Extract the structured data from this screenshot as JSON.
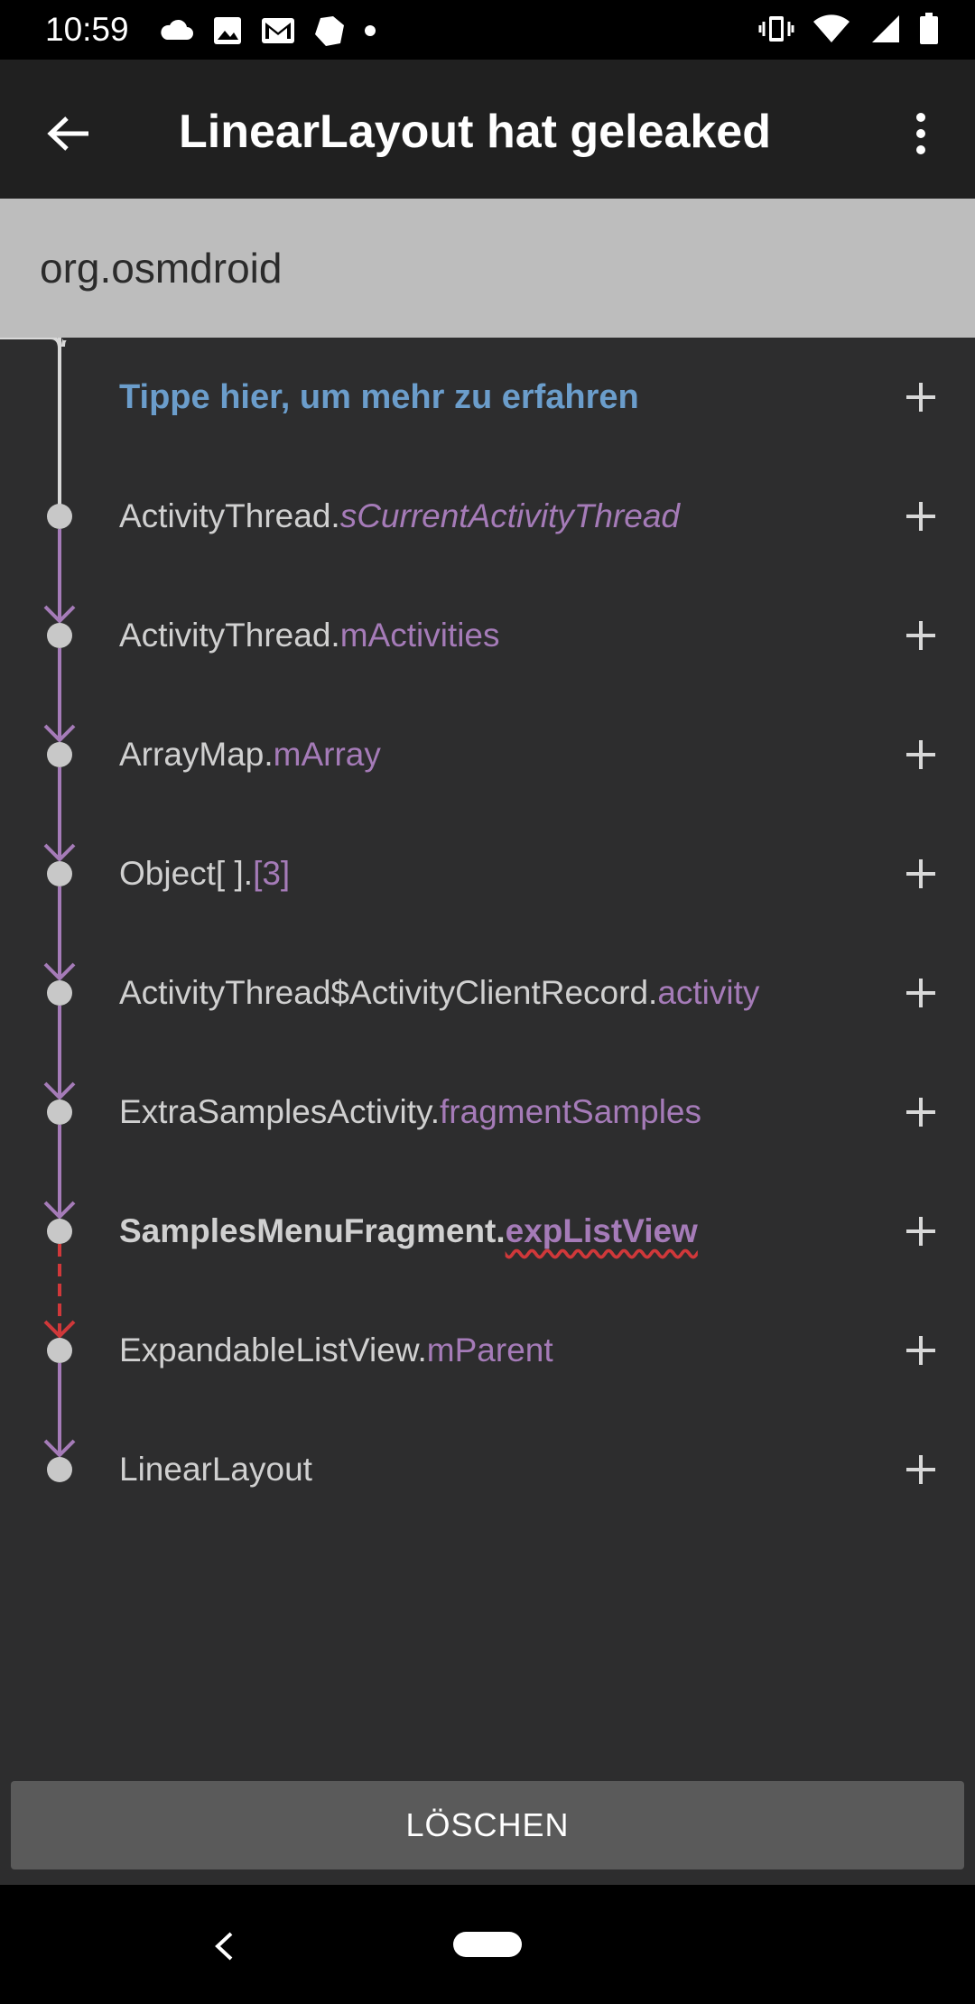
{
  "status_bar": {
    "time": "10:59",
    "left_icons": [
      "cloud-icon",
      "image-icon",
      "gmail-icon",
      "shield-app-icon",
      "dot-icon"
    ],
    "right_icons": [
      "vibrate-icon",
      "wifi-icon",
      "signal-icon",
      "battery-icon"
    ]
  },
  "app_bar": {
    "title": "LinearLayout hat geleaked",
    "back_icon": "arrow-left-icon",
    "overflow_icon": "more-vert-icon"
  },
  "package": {
    "name": "org.osmdroid"
  },
  "info_row": {
    "label": "Tippe hier, um mehr zu erfahren"
  },
  "trace": [
    {
      "cls": "ActivityThread.",
      "field": "sCurrentActivityThread"
    },
    {
      "cls": "ActivityThread.",
      "field": "mActivities"
    },
    {
      "cls": "ArrayMap.",
      "field": "mArray"
    },
    {
      "cls": "Object[ ].",
      "field": "[3]"
    },
    {
      "cls": "ActivityThread$ActivityClientRecord.",
      "field": "activity"
    },
    {
      "cls": "ExtraSamplesActivity.",
      "field": "fragmentSamples"
    },
    {
      "cls": "SamplesMenuFragment.",
      "field": "expListView"
    },
    {
      "cls": "ExpandableListView.",
      "field": "mParent"
    },
    {
      "cls": "LinearLayout",
      "field": ""
    }
  ],
  "delete_button": {
    "label": "LÖSCHEN"
  },
  "colors": {
    "accent_purple": "#a57bb8",
    "leak_red": "#d0383a",
    "info_blue": "#6b9dcb",
    "background": "#2d2d2e"
  }
}
